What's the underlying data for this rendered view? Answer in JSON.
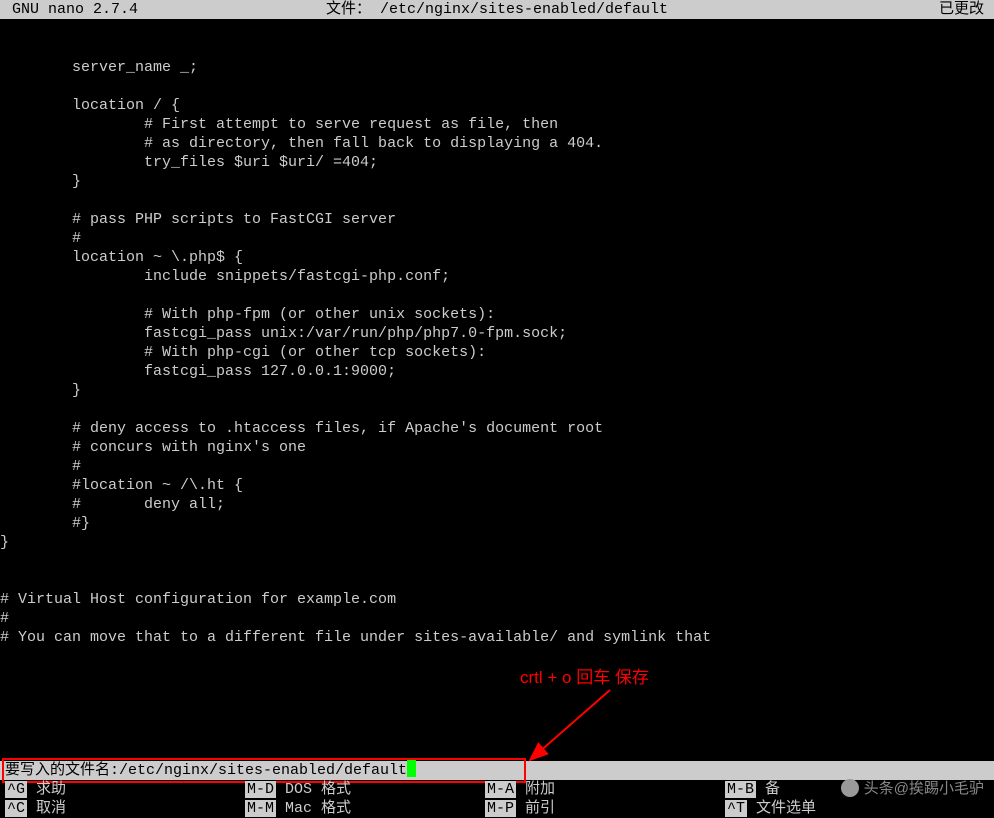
{
  "titlebar": {
    "app": "  GNU nano 2.7.4",
    "file_label": "文件： /etc/nginx/sites-enabled/default",
    "status": "已更改"
  },
  "editor_lines": [
    "",
    "        server_name _;",
    "",
    "        location / {",
    "                # First attempt to serve request as file, then",
    "                # as directory, then fall back to displaying a 404.",
    "                try_files $uri $uri/ =404;",
    "        }",
    "",
    "        # pass PHP scripts to FastCGI server",
    "        #",
    "        location ~ \\.php$ {",
    "                include snippets/fastcgi-php.conf;",
    "",
    "                # With php-fpm (or other unix sockets):",
    "                fastcgi_pass unix:/var/run/php/php7.0-fpm.sock;",
    "                # With php-cgi (or other tcp sockets):",
    "                fastcgi_pass 127.0.0.1:9000;",
    "        }",
    "",
    "        # deny access to .htaccess files, if Apache's document root",
    "        # concurs with nginx's one",
    "        #",
    "        #location ~ /\\.ht {",
    "        #       deny all;",
    "        #}",
    "}",
    "",
    "",
    "# Virtual Host configuration for example.com",
    "#",
    "# You can move that to a different file under sites-available/ and symlink that"
  ],
  "prompt": {
    "label": "要写入的文件名: ",
    "value": "/etc/nginx/sites-enabled/default"
  },
  "annotation": "crtl + o  回车  保存",
  "menu": {
    "row1": [
      {
        "key": "^G",
        "label": " 求助",
        "pos": 5
      },
      {
        "key": "M-D",
        "label": " DOS 格式",
        "pos": 245
      },
      {
        "key": "^C",
        "label": " 取消",
        "pos": 485
      },
      {
        "key": "M-A",
        "label": " 附加",
        "pos": 5
      },
      {
        "key": "M-B",
        "label": " 备",
        "pos": 725
      }
    ],
    "row2": [
      {
        "key": "^C",
        "label": " 取消",
        "pos": 5
      },
      {
        "key": "M-M",
        "label": " Mac 格式",
        "pos": 245
      },
      {
        "key": "M-P",
        "label": " 前引",
        "pos": 485
      },
      {
        "key": "^T",
        "label": " 文件选单",
        "pos": 725
      }
    ]
  },
  "watermark": "头条@挨踢小毛驴"
}
